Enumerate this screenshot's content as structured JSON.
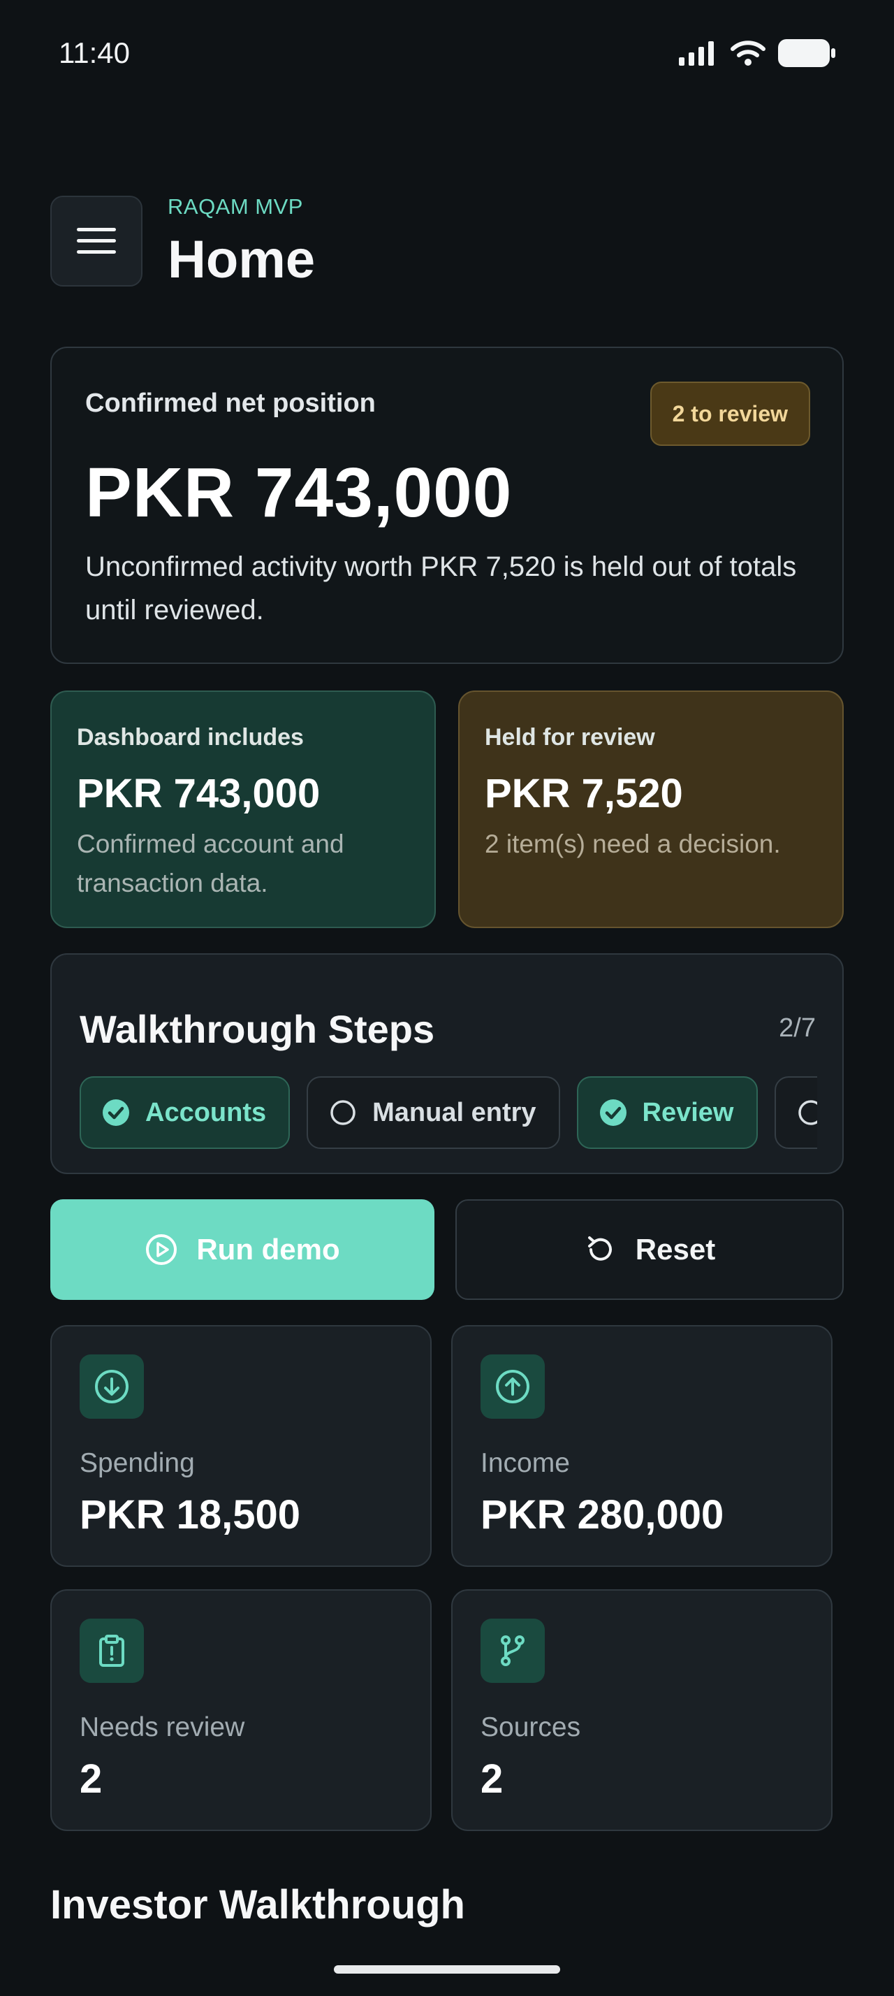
{
  "status_bar": {
    "time": "11:40"
  },
  "header": {
    "eyebrow": "RAQAM MVP",
    "title": "Home"
  },
  "net_position": {
    "label": "Confirmed net position",
    "badge": "2 to review",
    "amount": "PKR 743,000",
    "note": "Unconfirmed activity worth PKR 7,520 is held out of totals until reviewed."
  },
  "summary": {
    "included": {
      "label": "Dashboard includes",
      "amount": "PKR 743,000",
      "note": "Confirmed account and transaction data."
    },
    "held": {
      "label": "Held for review",
      "amount": "PKR 7,520",
      "note": "2 item(s) need a decision."
    }
  },
  "walkthrough": {
    "title": "Walkthrough Steps",
    "progress": "2/7",
    "steps": [
      {
        "label": "Accounts",
        "done": true
      },
      {
        "label": "Manual entry",
        "done": false
      },
      {
        "label": "Review",
        "done": true
      },
      {
        "label": "",
        "done": false
      }
    ]
  },
  "actions": {
    "run_demo": "Run demo",
    "reset": "Reset"
  },
  "stats": {
    "spending": {
      "label": "Spending",
      "value": "PKR 18,500",
      "icon": "arrow-down-circle-icon"
    },
    "income": {
      "label": "Income",
      "value": "PKR 280,000",
      "icon": "arrow-up-circle-icon"
    },
    "needs_review": {
      "label": "Needs review",
      "value": "2",
      "icon": "clipboard-alert-icon"
    },
    "sources": {
      "label": "Sources",
      "value": "2",
      "icon": "git-branch-icon"
    }
  },
  "section": {
    "title": "Investor Walkthrough"
  },
  "colors": {
    "accent": "#6ddbc3",
    "background": "#0e1215",
    "warning": "#f2d79a"
  }
}
